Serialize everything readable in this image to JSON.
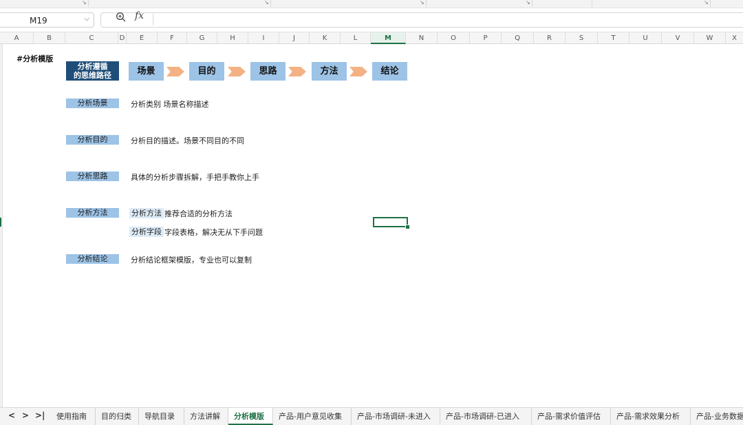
{
  "formula_bar": {
    "cell_ref": "M19",
    "fx_label": "fx",
    "formula": ""
  },
  "columns": [
    "A",
    "B",
    "C",
    "D",
    "E",
    "F",
    "G",
    "H",
    "I",
    "J",
    "K",
    "L",
    "M",
    "N",
    "O",
    "P",
    "Q",
    "R",
    "S",
    "T",
    "U",
    "V",
    "W",
    "X"
  ],
  "active_column": "M",
  "sheet": {
    "title": "#分析模版",
    "flow_head": [
      "分析遵循",
      "的思维路径"
    ],
    "flow_steps": [
      "场景",
      "目的",
      "思路",
      "方法",
      "结论"
    ],
    "sections": [
      {
        "label": "分析场景",
        "desc": "分析类别  场景名称描述"
      },
      {
        "label": "分析目的",
        "desc": "分析目的描述。场景不同目的不同"
      },
      {
        "label": "分析思路",
        "desc": "具体的分析步骤拆解，手把手教你上手"
      },
      {
        "label": "分析方法",
        "sub": [
          {
            "tag": "分析方法",
            "desc": "推荐合适的分析方法"
          },
          {
            "tag": "分析字段",
            "desc": "字段表格，解决无从下手问题"
          }
        ]
      },
      {
        "label": "分析结论",
        "desc": "分析结论框架模版，专业也可以复制"
      }
    ]
  },
  "tabs": {
    "nav": [
      "<",
      ">",
      ">|"
    ],
    "items": [
      "使用指南",
      "目的归类",
      "导航目录",
      "方法讲解",
      "分析模版",
      "产品-用户意见收集",
      "产品-市场调研-未进入",
      "产品-市场调研-已进入",
      "产品-需求价值评估",
      "产品-需求效果分析",
      "产品-业务数据"
    ],
    "active": "分析模版"
  },
  "colors": {
    "accent": "#1e7145",
    "head_fill": "#1f4e79",
    "box_fill": "#9dc3e6",
    "arrow_fill": "#f4b183",
    "tag_fill": "#ddebf7"
  }
}
